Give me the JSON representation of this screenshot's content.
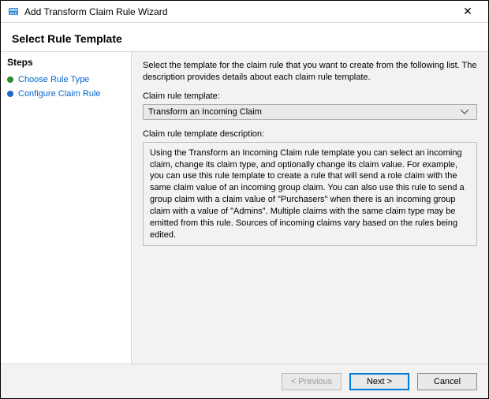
{
  "titlebar": {
    "title": "Add Transform Claim Rule Wizard",
    "close_icon": "✕"
  },
  "header": {
    "title": "Select Rule Template"
  },
  "sidebar": {
    "heading": "Steps",
    "items": [
      {
        "label": "Choose Rule Type",
        "state": "current"
      },
      {
        "label": "Configure Claim Rule",
        "state": "upcoming"
      }
    ]
  },
  "main": {
    "intro": "Select the template for the claim rule that you want to create from the following list. The description provides details about each claim rule template.",
    "template_label": "Claim rule template:",
    "template_selected": "Transform an Incoming Claim",
    "description_label": "Claim rule template description:",
    "description_text": "Using the Transform an Incoming Claim rule template you can select an incoming claim, change its claim type, and optionally change its claim value.  For example, you can use this rule template to create a rule that will send a role claim with the same claim value of an incoming group claim.  You can also use this rule to send a group claim with a claim value of \"Purchasers\" when there is an incoming group claim with a value of \"Admins\".  Multiple claims with the same claim type may be emitted from this rule.  Sources of incoming claims vary based on the rules being edited."
  },
  "footer": {
    "previous": "< Previous",
    "next": "Next >",
    "cancel": "Cancel"
  }
}
